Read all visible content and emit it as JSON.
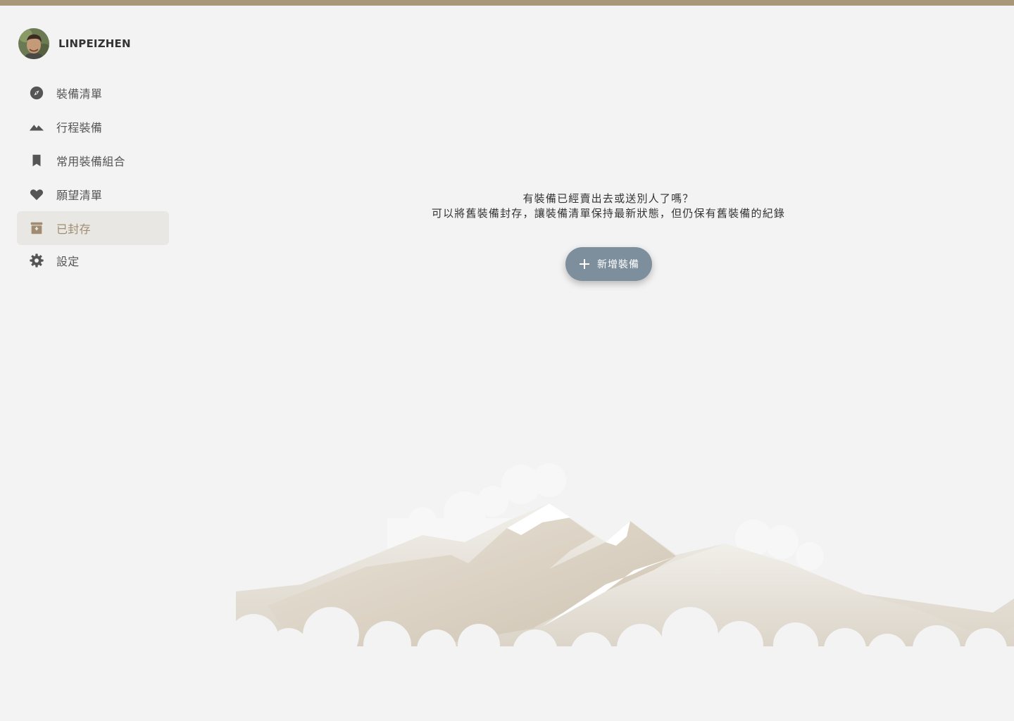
{
  "colors": {
    "top_bar": "#a89878",
    "background": "#f3f3f3",
    "active_nav_bg": "#e9e7e4",
    "active_nav_text": "#a08c70",
    "button_bg": "#7d8e9d"
  },
  "user": {
    "name": "LINPEIZHEN",
    "avatar": "avatar-icon"
  },
  "nav": {
    "items": [
      {
        "label": "裝備清單",
        "icon": "compass-icon"
      },
      {
        "label": "行程裝備",
        "icon": "mountain-icon"
      },
      {
        "label": "常用裝備組合",
        "icon": "bookmark-icon"
      },
      {
        "label": "願望清單",
        "icon": "heart-icon"
      },
      {
        "label": "已封存",
        "icon": "archive-icon",
        "active": true
      },
      {
        "label": "設定",
        "icon": "gear-icon"
      }
    ]
  },
  "empty_state": {
    "line1": "有裝備已經賣出去或送別人了嗎？",
    "line2": "可以將舊裝備封存，讓裝備清單保持最新狀態，但仍保有舊裝備的紀錄",
    "button_label": "新增裝備",
    "button_icon": "plus-icon",
    "illustration": "mountain-illustration"
  }
}
